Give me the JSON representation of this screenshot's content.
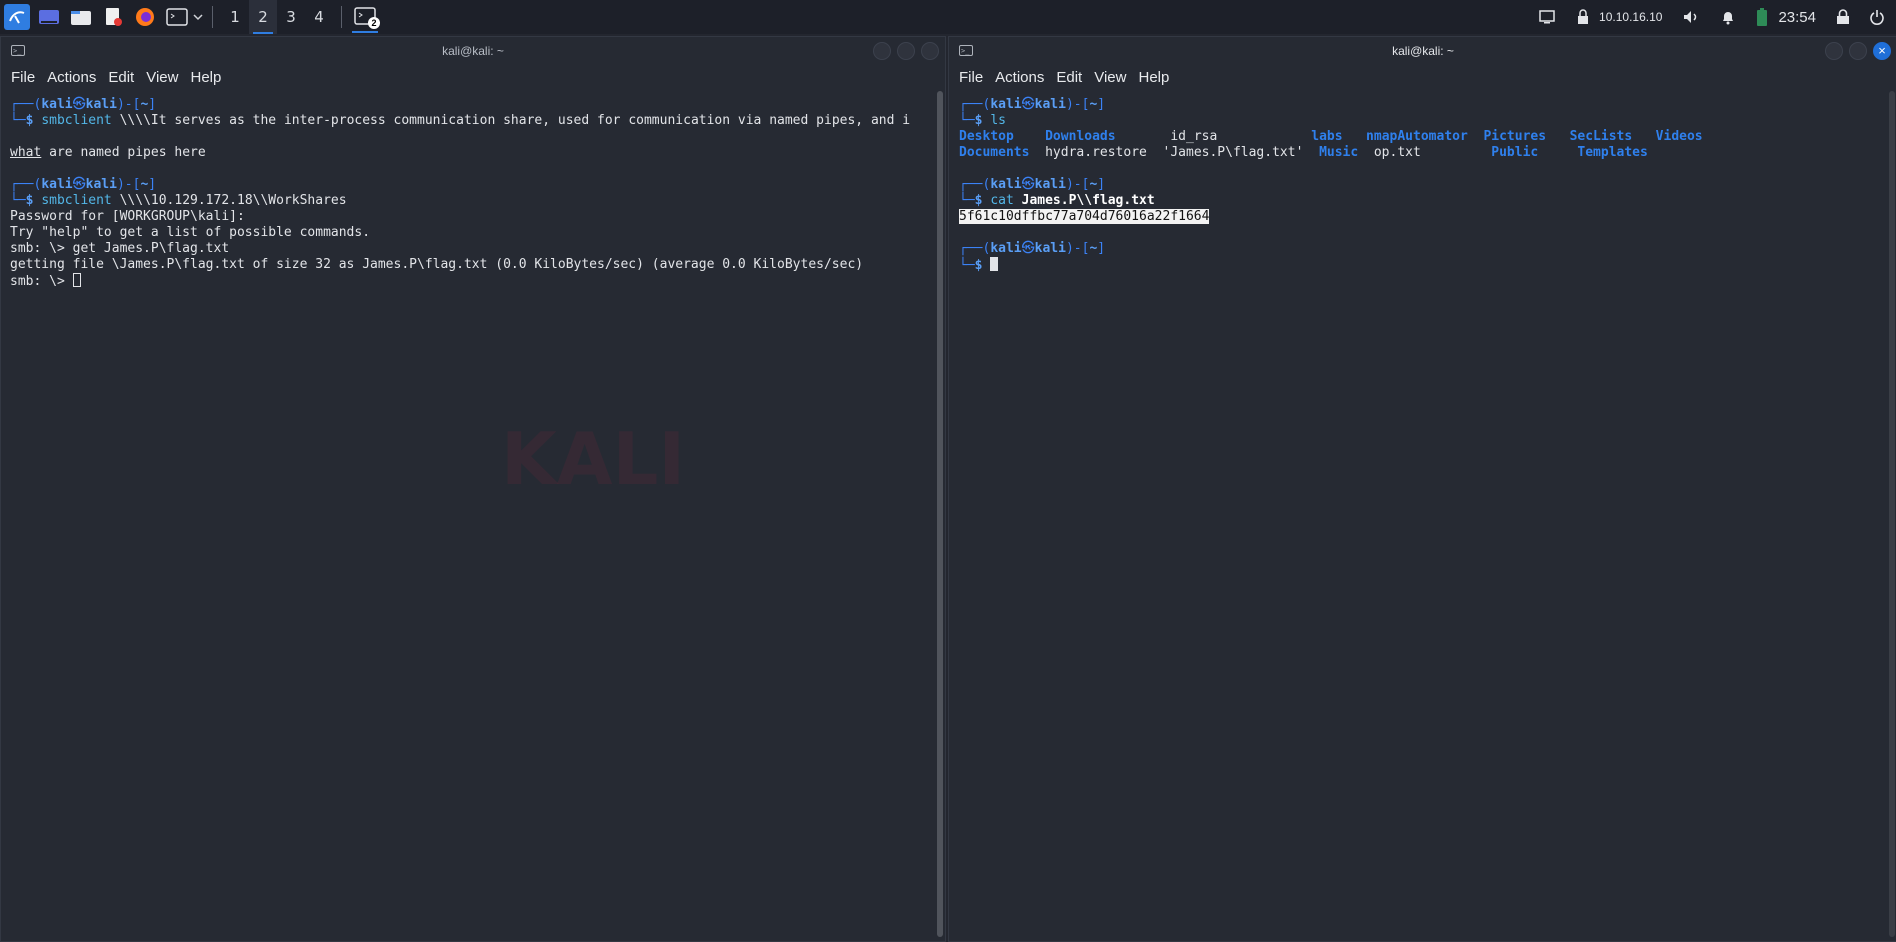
{
  "taskbar": {
    "launchers": [
      "kali-menu-icon",
      "desktop-icon",
      "file-manager-icon",
      "text-editor-icon",
      "firefox-icon",
      "terminal-icon",
      "dropdown-icon"
    ],
    "workspaces": [
      "1",
      "2",
      "3",
      "4"
    ],
    "active_workspace": "2",
    "task_badge": "2",
    "tray": {
      "ip": "10.10.16.10",
      "time": "23:54"
    }
  },
  "left": {
    "title": "kali@kali: ~",
    "menu": [
      "File",
      "Actions",
      "Edit",
      "View",
      "Help"
    ],
    "lines": [
      {
        "type": "prompt_top",
        "user": "kali",
        "host": "kali",
        "cwd": "~"
      },
      {
        "type": "prompt_cmd",
        "cmd": "smbclient",
        "args": " \\\\\\\\It serves as the inter-process communication share, used for communication via named pipes, and i"
      },
      {
        "type": "blank"
      },
      {
        "type": "pipes",
        "u": "what",
        "rest": " are named pipes here"
      },
      {
        "type": "blank"
      },
      {
        "type": "prompt_top",
        "user": "kali",
        "host": "kali",
        "cwd": "~"
      },
      {
        "type": "prompt_cmd",
        "cmd": "smbclient",
        "args": " \\\\\\\\10.129.172.18\\\\WorkShares"
      },
      {
        "type": "text",
        "text": "Password for [WORKGROUP\\kali]:"
      },
      {
        "type": "text",
        "text": "Try \"help\" to get a list of possible commands."
      },
      {
        "type": "text",
        "text": "smb: \\> get James.P\\flag.txt"
      },
      {
        "type": "text",
        "text": "getting file \\James.P\\flag.txt of size 32 as James.P\\flag.txt (0.0 KiloBytes/sec) (average 0.0 KiloBytes/sec)"
      },
      {
        "type": "smbprompt",
        "text": "smb: \\> "
      }
    ]
  },
  "right": {
    "title": "kali@kali: ~",
    "menu": [
      "File",
      "Actions",
      "Edit",
      "View",
      "Help"
    ],
    "prompt_user": "kali",
    "prompt_host": "kali",
    "prompt_cwd": "~",
    "cmd1": "ls",
    "ls_row1": [
      {
        "name": "Desktop",
        "dir": true,
        "pad": "    "
      },
      {
        "name": "Downloads",
        "dir": true,
        "pad": "       "
      },
      {
        "name": "id_rsa",
        "dir": false,
        "pad": "            "
      },
      {
        "name": "labs",
        "dir": true,
        "pad": "   "
      },
      {
        "name": "nmapAutomator",
        "dir": true,
        "pad": "  "
      },
      {
        "name": "Pictures",
        "dir": true,
        "pad": "   "
      },
      {
        "name": "SecLists",
        "dir": true,
        "pad": "   "
      },
      {
        "name": "Videos",
        "dir": true,
        "pad": ""
      }
    ],
    "ls_row2": [
      {
        "name": "Documents",
        "dir": true,
        "pad": "  "
      },
      {
        "name": "hydra.restore",
        "dir": false,
        "pad": "  "
      },
      {
        "name": "'James.P\\flag.txt'",
        "dir": false,
        "pad": "  "
      },
      {
        "name": "Music",
        "dir": true,
        "pad": "  "
      },
      {
        "name": "op.txt",
        "dir": false,
        "pad": "         "
      },
      {
        "name": "Public",
        "dir": true,
        "pad": "     "
      },
      {
        "name": "Templates",
        "dir": true,
        "pad": ""
      }
    ],
    "cmd2": "cat",
    "cmd2_arg": "James.P\\\\flag.txt",
    "flag": "5f61c10dffbc77a704d76016a22f1664"
  }
}
